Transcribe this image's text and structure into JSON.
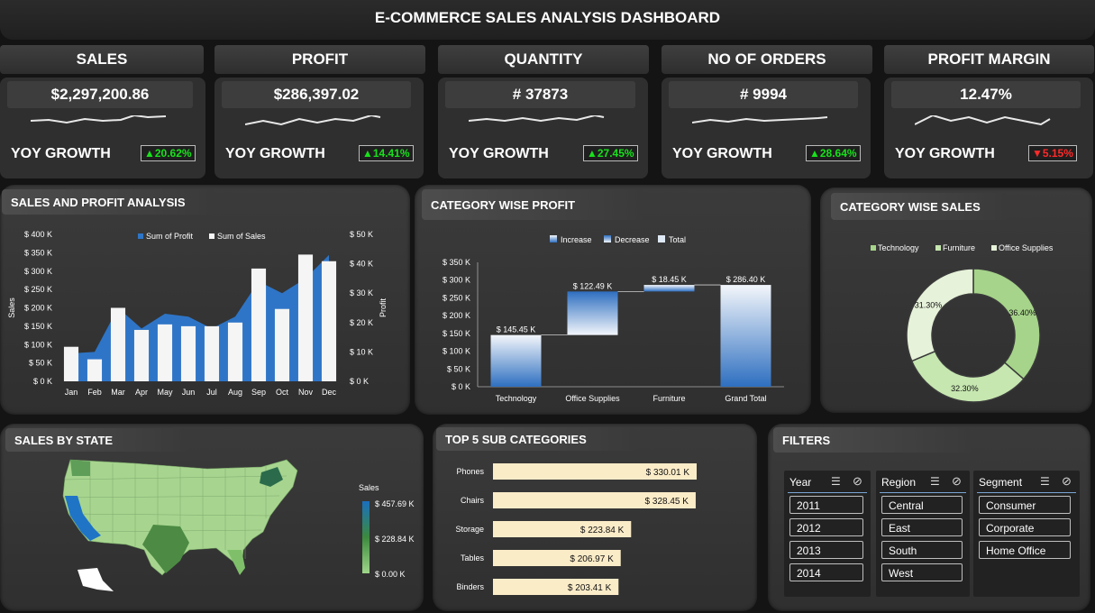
{
  "header": {
    "title": "E-COMMERCE SALES ANALYSIS DASHBOARD"
  },
  "kpis": [
    {
      "label": "SALES",
      "value": "$2,297,200.86",
      "yoy_label": "YOY GROWTH",
      "yoy": "▲20.62%",
      "trend": "up"
    },
    {
      "label": "PROFIT",
      "value": "$286,397.02",
      "yoy_label": "YOY GROWTH",
      "yoy": "▲14.41%",
      "trend": "up"
    },
    {
      "label": "QUANTITY",
      "value": "# 37873",
      "yoy_label": "YOY GROWTH",
      "yoy": "▲27.45%",
      "trend": "up"
    },
    {
      "label": "NO OF ORDERS",
      "value": "# 9994",
      "yoy_label": "YOY GROWTH",
      "yoy": "▲28.64%",
      "trend": "up"
    },
    {
      "label": "PROFIT MARGIN",
      "value": "12.47%",
      "yoy_label": "YOY GROWTH",
      "yoy": "▼5.15%",
      "trend": "down"
    }
  ],
  "panels": {
    "sales_profit": "SALES AND PROFIT ANALYSIS",
    "category_profit": "CATEGORY WISE PROFIT",
    "category_sales": "CATEGORY WISE SALES",
    "sales_by_state": "SALES BY STATE",
    "top5": "TOP 5 SUB CATEGORIES",
    "filters": "FILTERS"
  },
  "chart_data": [
    {
      "type": "bar",
      "title": "SALES AND PROFIT ANALYSIS",
      "categories": [
        "Jan",
        "Feb",
        "Mar",
        "Apr",
        "May",
        "Jun",
        "Jul",
        "Aug",
        "Sep",
        "Oct",
        "Nov",
        "Dec"
      ],
      "series": [
        {
          "name": "Sum of Profit",
          "chart": "area",
          "axis": "right",
          "color": "#2e75c7",
          "values": [
            9500,
            10000,
            25000,
            18000,
            23000,
            22000,
            18000,
            22000,
            34000,
            30000,
            35000,
            43000
          ]
        },
        {
          "name": "Sum of Sales",
          "chart": "bar",
          "axis": "left",
          "color": "#f5f5f5",
          "values": [
            94000,
            60000,
            200000,
            140000,
            155000,
            150000,
            150000,
            160000,
            307000,
            197000,
            345000,
            327000
          ]
        }
      ],
      "ylabel": "Sales",
      "y2label": "Profit",
      "ylim": [
        0,
        400000
      ],
      "y2lim": [
        0,
        50000
      ],
      "y_ticks": [
        "$ 0 K",
        "$ 50 K",
        "$ 100 K",
        "$ 150 K",
        "$ 200 K",
        "$ 250 K",
        "$ 300 K",
        "$ 350 K",
        "$ 400 K"
      ],
      "y2_ticks": [
        "$ 0 K",
        "$ 10 K",
        "$ 20 K",
        "$ 30 K",
        "$ 40 K",
        "$ 50 K"
      ],
      "legend": "top"
    },
    {
      "type": "bar",
      "subtype": "waterfall",
      "title": "CATEGORY WISE PROFIT",
      "categories": [
        "Technology",
        "Office Supplies",
        "Furniture",
        "Grand Total"
      ],
      "values": [
        145.45,
        122.49,
        18.45,
        286.4
      ],
      "labels": [
        "$ 145.45 K",
        "$ 122.49 K",
        "$ 18.45 K",
        "$ 286.40 K"
      ],
      "legend": [
        "Increase",
        "Decrease",
        "Total"
      ],
      "ylim": [
        0,
        350
      ],
      "y_ticks": [
        "$ 0 K",
        "$ 50 K",
        "$ 100 K",
        "$ 150 K",
        "$ 200 K",
        "$ 250 K",
        "$ 300 K",
        "$ 350 K"
      ]
    },
    {
      "type": "pie",
      "subtype": "donut",
      "title": "CATEGORY WISE SALES",
      "categories": [
        "Technology",
        "Furniture",
        "Office Supplies"
      ],
      "values": [
        36.4,
        32.3,
        31.3
      ],
      "labels": [
        "36.40%",
        "32.30%",
        "31.30%"
      ],
      "colors": [
        "#a6d48a",
        "#c6e7b0",
        "#e6f2d9"
      ],
      "legend": "top"
    },
    {
      "type": "bar",
      "orientation": "horizontal",
      "title": "TOP 5 SUB CATEGORIES",
      "categories": [
        "Phones",
        "Chairs",
        "Storage",
        "Tables",
        "Binders"
      ],
      "values": [
        330.01,
        328.45,
        223.84,
        206.97,
        203.41
      ],
      "labels": [
        "$ 330.01 K",
        "$ 328.45 K",
        "$ 223.84 K",
        "$ 206.97 K",
        "$ 203.41 K"
      ],
      "color": "#fbecc8"
    }
  ],
  "map": {
    "legend_title": "Sales",
    "legend_max": "$ 457.69 K",
    "legend_mid": "$ 228.84 K",
    "legend_min": "$ 0.00 K"
  },
  "filters": {
    "year": {
      "title": "Year",
      "items": [
        "2011",
        "2012",
        "2013",
        "2014"
      ]
    },
    "region": {
      "title": "Region",
      "items": [
        "Central",
        "East",
        "South",
        "West"
      ]
    },
    "segment": {
      "title": "Segment",
      "items": [
        "Consumer",
        "Corporate",
        "Home Office"
      ]
    }
  }
}
